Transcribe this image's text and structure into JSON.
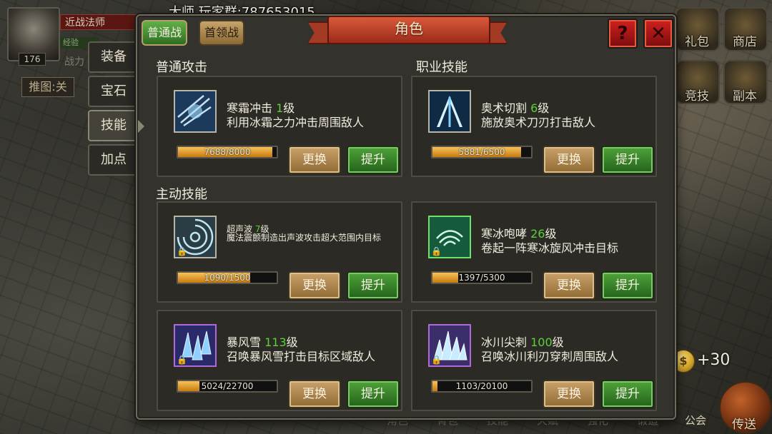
{
  "top_caption": "大师 玩家群:787653015",
  "title": "角色",
  "modes": {
    "active": "普通战",
    "inactive": "首领战"
  },
  "icons": {
    "help": "?",
    "close": "✕"
  },
  "side_tabs": [
    "装备",
    "宝石",
    "技能",
    "加点"
  ],
  "sections": {
    "normal_attack": "普通攻击",
    "class_skill": "职业技能",
    "active_skill": "主动技能"
  },
  "buttons": {
    "replace": "更换",
    "upgrade": "提升"
  },
  "skills": [
    {
      "name": "寒霜冲击",
      "level": "1",
      "level_suffix": "级",
      "desc": "利用冰霜之力冲击周围敌人",
      "progress": "7688/8000",
      "ratio": 0.96,
      "locked": false
    },
    {
      "name": "奥术切割",
      "level": "6",
      "level_suffix": "级",
      "desc": "施放奥术刀刃打击敌人",
      "progress": "5881/6500",
      "ratio": 0.9,
      "locked": false
    },
    {
      "name": "超声波",
      "level": "7",
      "level_suffix": "级",
      "desc": "魔法震颤制造出声波攻击超大范围内目标",
      "progress": "1090/1500",
      "ratio": 0.73,
      "locked": true
    },
    {
      "name": "寒冰咆哮",
      "level": "26",
      "level_suffix": "级",
      "desc": "卷起一阵寒冰旋风冲击目标",
      "progress": "1397/5300",
      "ratio": 0.26,
      "locked": true
    },
    {
      "name": "暴风雪",
      "level": "113",
      "level_suffix": "级",
      "desc": "召唤暴风雪打击目标区域敌人",
      "progress": "5024/22700",
      "ratio": 0.22,
      "locked": true
    },
    {
      "name": "冰川尖刺",
      "level": "100",
      "level_suffix": "级",
      "desc": "召唤冰川利刃穿刺周围敌人",
      "progress": "1103/20100",
      "ratio": 0.05,
      "locked": true
    }
  ],
  "hud": {
    "player_level": "176",
    "class_name": "近战法师",
    "exp_label": "经验",
    "power_label": "战力",
    "push_stage": "推图:关",
    "gift": "礼包",
    "shop": "商店",
    "arena": "竞技",
    "dungeon": "副本",
    "coin_bonus": "+30",
    "coin_symbol": "$",
    "send": "传送",
    "guild": "公会",
    "bottom_tabs": [
      "角色",
      "背包",
      "技能",
      "天赋",
      "强化",
      "锻造"
    ]
  },
  "colors": {
    "level_green": "#5ad13a",
    "banner_red": "#c0432a",
    "bar_orange": "#f0a53a"
  }
}
